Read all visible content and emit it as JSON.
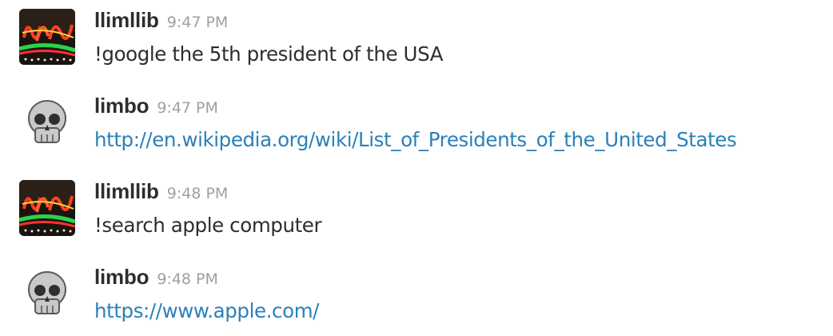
{
  "messages": [
    {
      "username": "llimllib",
      "time": "9:47 PM",
      "text": "!google the 5th president of the USA",
      "avatar_icon": "neon-sign-avatar",
      "is_link": false
    },
    {
      "username": "limbo",
      "time": "9:47 PM",
      "text": "http://en.wikipedia.org/wiki/List_of_Presidents_of_the_United_States",
      "avatar_icon": "skull-icon",
      "is_link": true
    },
    {
      "username": "llimllib",
      "time": "9:48 PM",
      "text": "!search apple computer",
      "avatar_icon": "neon-sign-avatar",
      "is_link": false
    },
    {
      "username": "limbo",
      "time": "9:48 PM",
      "text": "https://www.apple.com/",
      "avatar_icon": "skull-icon",
      "is_link": true
    }
  ],
  "colors": {
    "username": "#2c2d30",
    "timestamp": "#a0a0a2",
    "text": "#2c2d30",
    "link": "#2a80b9"
  }
}
